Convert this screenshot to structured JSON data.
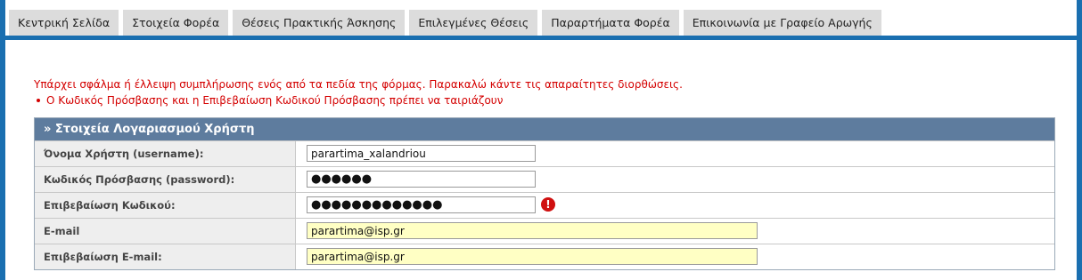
{
  "tabs": [
    {
      "label": "Κεντρική Σελίδα"
    },
    {
      "label": "Στοιχεία Φορέα"
    },
    {
      "label": "Θέσεις Πρακτικής Άσκησης"
    },
    {
      "label": "Επιλεγμένες Θέσεις"
    },
    {
      "label": "Παραρτήματα Φορέα"
    },
    {
      "label": "Επικοινωνία με Γραφείο Αρωγής"
    }
  ],
  "error": {
    "message": "Υπάρχει σφάλμα ή έλλειψη συμπλήρωσης ενός από τα πεδία της φόρμας. Παρακαλώ κάντε τις απαραίτητες διορθώσεις.",
    "items": [
      "Ο Κωδικός Πρόσβασης και η Επιβεβαίωση Κωδικού Πρόσβασης πρέπει να ταιριάζουν"
    ]
  },
  "panel": {
    "title": "» Στοιχεία Λογαριασμού Χρήστη",
    "fields": [
      {
        "label": "Όνομα Χρήστη (username):",
        "value": "parartima_xalandriou"
      },
      {
        "label": "Κωδικός Πρόσβασης (password):",
        "value": "●●●●●●"
      },
      {
        "label": "Επιβεβαίωση Κωδικού:",
        "value": "●●●●●●●●●●●●●",
        "error_icon": "!"
      },
      {
        "label": "E-mail",
        "value": "parartima@isp.gr"
      },
      {
        "label": "Επιβεβαίωση E-mail:",
        "value": "parartima@isp.gr"
      }
    ]
  },
  "colors": {
    "frame": "#1a6fb0",
    "panel_header": "#5e7c9e",
    "error_text": "#d40000",
    "highlight_input": "#ffffc4"
  },
  "icons": {
    "error": "exclamation-circle-icon"
  }
}
